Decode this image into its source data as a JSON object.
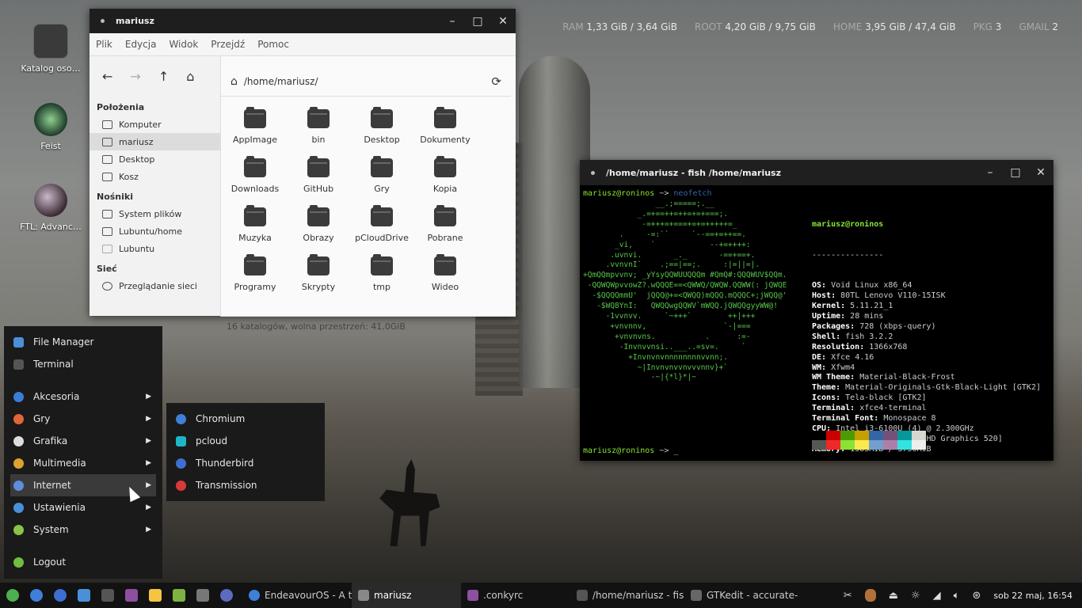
{
  "conky": [
    {
      "key": "RAM",
      "value": "1,33 GiB / 3,64 GiB"
    },
    {
      "key": "ROOT",
      "value": "4,20 GiB / 9,75 GiB"
    },
    {
      "key": "HOME",
      "value": "3,95 GiB / 47,4 GiB"
    },
    {
      "key": "PKG",
      "value": "3"
    },
    {
      "key": "GMAIL",
      "value": "2"
    }
  ],
  "desktop_icons": [
    "Katalog oso…",
    "Feist",
    "FTL: Advanc…"
  ],
  "file_manager": {
    "title": "mariusz",
    "menu": [
      "Plik",
      "Edycja",
      "Widok",
      "Przejdź",
      "Pomoc"
    ],
    "path": "/home/mariusz/",
    "sections": [
      {
        "heading": "Położenia",
        "items": [
          "Komputer",
          "mariusz",
          "Desktop",
          "Kosz"
        ]
      },
      {
        "heading": "Nośniki",
        "items": [
          "System plików",
          "Lubuntu/home",
          "Lubuntu"
        ]
      },
      {
        "heading": "Sieć",
        "items": [
          "Przeglądanie sieci"
        ]
      }
    ],
    "files": [
      "AppImage",
      "bin",
      "Desktop",
      "Dokumenty",
      "Downloads",
      "GitHub",
      "Gry",
      "Kopia",
      "Muzyka",
      "Obrazy",
      "pCloudDrive",
      "Pobrane",
      "Programy",
      "Skrypty",
      "tmp",
      "Wideo"
    ],
    "status": "16 katalogów, wolna przestrzeń: 41,0GiB"
  },
  "terminal": {
    "title": "/home/mariusz - fish /home/mariusz",
    "prompt_user": "mariusz@roninos",
    "prompt_sym": " ~> ",
    "command": "neofetch",
    "header": "mariusz@roninos",
    "rule": "---------------",
    "info": [
      {
        "k": "OS",
        "v": "Void Linux x86_64"
      },
      {
        "k": "Host",
        "v": "80TL Lenovo V110-15ISK"
      },
      {
        "k": "Kernel",
        "v": "5.11.21_1"
      },
      {
        "k": "Uptime",
        "v": "28 mins"
      },
      {
        "k": "Packages",
        "v": "728 (xbps-query)"
      },
      {
        "k": "Shell",
        "v": "fish 3.2.2"
      },
      {
        "k": "Resolution",
        "v": "1366x768"
      },
      {
        "k": "DE",
        "v": "Xfce 4.16"
      },
      {
        "k": "WM",
        "v": "Xfwm4"
      },
      {
        "k": "WM Theme",
        "v": "Material-Black-Frost"
      },
      {
        "k": "Theme",
        "v": "Material-Originals-Gtk-Black-Light [GTK2]"
      },
      {
        "k": "Icons",
        "v": "Tela-black [GTK2]"
      },
      {
        "k": "Terminal",
        "v": "xfce4-terminal"
      },
      {
        "k": "Terminal Font",
        "v": "Monospace 8"
      },
      {
        "k": "CPU",
        "v": "Intel i3-6100U (4) @ 2.300GHz"
      },
      {
        "k": "GPU",
        "v": "Intel Skylake GT2 [HD Graphics 520]"
      },
      {
        "k": "Memory",
        "v": "1583MiB / 3730MiB"
      }
    ],
    "palette": [
      "#000000",
      "#cc0000",
      "#4e9a06",
      "#c4a000",
      "#3465a4",
      "#75507b",
      "#06989a",
      "#d3d7cf",
      "#555753",
      "#ef2929",
      "#8ae234",
      "#fce94f",
      "#729fcf",
      "#ad7fa8",
      "#34e2e2",
      "#eeeeec"
    ],
    "cursor": "_"
  },
  "menu": {
    "items": [
      {
        "label": "File Manager",
        "color": "#4a90d9",
        "sub": false
      },
      {
        "label": "Terminal",
        "color": "#555555",
        "sub": false
      },
      {
        "label": "Akcesoria",
        "color": "#3b7dd8",
        "sub": true
      },
      {
        "label": "Gry",
        "color": "#e0673a",
        "sub": true
      },
      {
        "label": "Grafika",
        "color": "#dddddd",
        "sub": true
      },
      {
        "label": "Multimedia",
        "color": "#e0a030",
        "sub": true
      },
      {
        "label": "Internet",
        "color": "#5d8fd8",
        "sub": true
      },
      {
        "label": "Ustawienia",
        "color": "#4a90d9",
        "sub": true
      },
      {
        "label": "System",
        "color": "#8bc34a",
        "sub": true
      },
      {
        "label": "Logout",
        "color": "#6fbf3f",
        "sub": false
      }
    ],
    "submenu": [
      {
        "label": "Chromium",
        "color": "#3f7fd8"
      },
      {
        "label": "pcloud",
        "color": "#1fb5c8"
      },
      {
        "label": "Thunderbird",
        "color": "#3d6fd0"
      },
      {
        "label": "Transmission",
        "color": "#d83a3a"
      }
    ]
  },
  "taskbar": {
    "tasks": [
      {
        "label": "EndeavourOS - A te…",
        "active": false
      },
      {
        "label": "mariusz",
        "active": true
      },
      {
        "label": ".conkyrc",
        "active": false
      },
      {
        "label": "/home/mariusz - fis…",
        "active": false
      },
      {
        "label": "GTKedit - accurate-r…",
        "active": false
      }
    ],
    "clock": "sob 22 maj, 16:54"
  }
}
